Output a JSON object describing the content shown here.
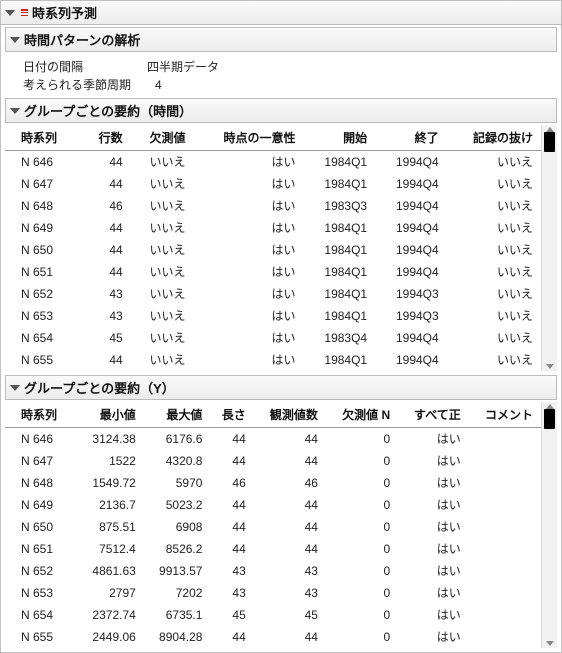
{
  "main": {
    "title": "時系列予測"
  },
  "pattern": {
    "title": "時間パターンの解析",
    "rows": [
      {
        "key": "日付の間隔",
        "val": "四半期データ"
      },
      {
        "key": "考えられる季節周期",
        "val": "4"
      }
    ]
  },
  "summary_time": {
    "title": "グループごとの要約（時間）",
    "columns": [
      "時系列",
      "行数",
      "欠測値",
      "時点の一意性",
      "開始",
      "終了",
      "記録の抜け"
    ],
    "rows": [
      [
        "N 646",
        "44",
        "いいえ",
        "はい",
        "1984Q1",
        "1994Q4",
        "いいえ"
      ],
      [
        "N 647",
        "44",
        "いいえ",
        "はい",
        "1984Q1",
        "1994Q4",
        "いいえ"
      ],
      [
        "N 648",
        "46",
        "いいえ",
        "はい",
        "1983Q3",
        "1994Q4",
        "いいえ"
      ],
      [
        "N 649",
        "44",
        "いいえ",
        "はい",
        "1984Q1",
        "1994Q4",
        "いいえ"
      ],
      [
        "N 650",
        "44",
        "いいえ",
        "はい",
        "1984Q1",
        "1994Q4",
        "いいえ"
      ],
      [
        "N 651",
        "44",
        "いいえ",
        "はい",
        "1984Q1",
        "1994Q4",
        "いいえ"
      ],
      [
        "N 652",
        "43",
        "いいえ",
        "はい",
        "1984Q1",
        "1994Q3",
        "いいえ"
      ],
      [
        "N 653",
        "43",
        "いいえ",
        "はい",
        "1984Q1",
        "1994Q3",
        "いいえ"
      ],
      [
        "N 654",
        "45",
        "いいえ",
        "はい",
        "1983Q4",
        "1994Q4",
        "いいえ"
      ],
      [
        "N 655",
        "44",
        "いいえ",
        "はい",
        "1984Q1",
        "1994Q4",
        "いいえ"
      ]
    ]
  },
  "summary_y": {
    "title": "グループごとの要約（Y）",
    "columns": [
      "時系列",
      "最小値",
      "最大値",
      "長さ",
      "観測値数",
      "欠測値 N",
      "すべて正",
      "コメント"
    ],
    "rows": [
      [
        "N 646",
        "3124.38",
        "6176.6",
        "44",
        "44",
        "0",
        "はい",
        ""
      ],
      [
        "N 647",
        "1522",
        "4320.8",
        "44",
        "44",
        "0",
        "はい",
        ""
      ],
      [
        "N 648",
        "1549.72",
        "5970",
        "46",
        "46",
        "0",
        "はい",
        ""
      ],
      [
        "N 649",
        "2136.7",
        "5023.2",
        "44",
        "44",
        "0",
        "はい",
        ""
      ],
      [
        "N 650",
        "875.51",
        "6908",
        "44",
        "44",
        "0",
        "はい",
        ""
      ],
      [
        "N 651",
        "7512.4",
        "8526.2",
        "44",
        "44",
        "0",
        "はい",
        ""
      ],
      [
        "N 652",
        "4861.63",
        "9913.57",
        "43",
        "43",
        "0",
        "はい",
        ""
      ],
      [
        "N 653",
        "2797",
        "7202",
        "43",
        "43",
        "0",
        "はい",
        ""
      ],
      [
        "N 654",
        "2372.74",
        "6735.1",
        "45",
        "45",
        "0",
        "はい",
        ""
      ],
      [
        "N 655",
        "2449.06",
        "8904.28",
        "44",
        "44",
        "0",
        "はい",
        ""
      ]
    ]
  }
}
